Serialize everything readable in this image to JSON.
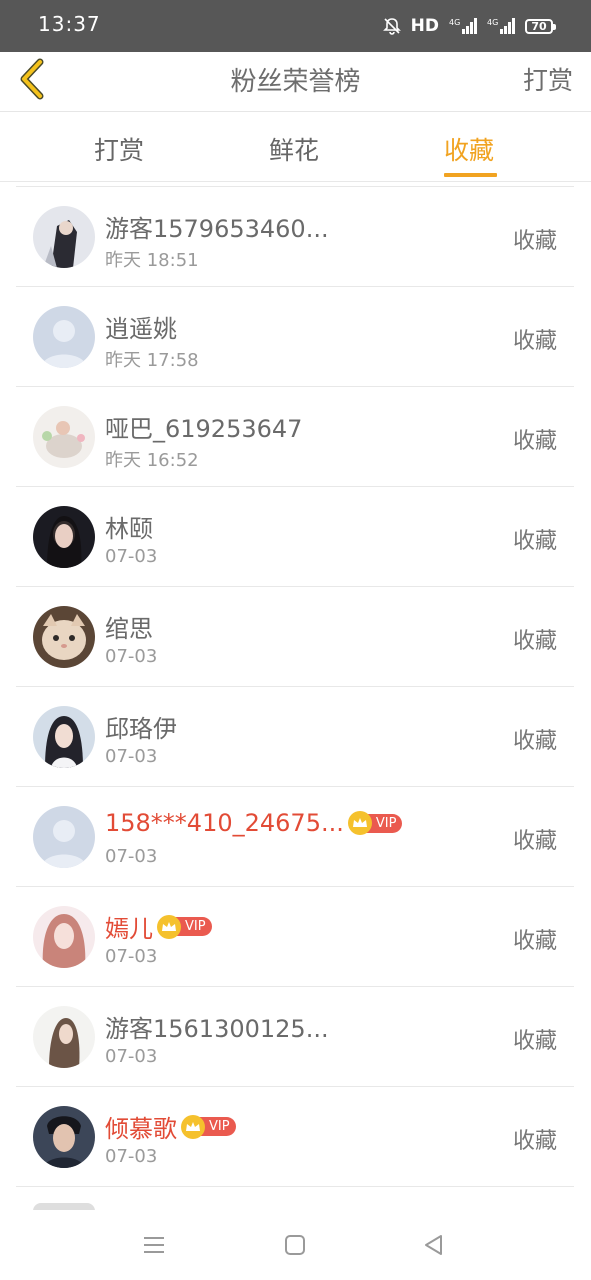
{
  "status_bar": {
    "time": "13:37",
    "network": "HD",
    "network_gen": "4G",
    "battery": "70"
  },
  "header": {
    "title": "粉丝荣誉榜",
    "action_label": "打赏",
    "back_icon": "chevron-left-icon",
    "accent_color": "#f1a321"
  },
  "tabs": [
    {
      "label": "打赏",
      "active": false
    },
    {
      "label": "鲜花",
      "active": false
    },
    {
      "label": "收藏",
      "active": true
    }
  ],
  "list": [
    {
      "name": "游客1579653460...",
      "time": "昨天 18:51",
      "action": "收藏",
      "vip": false
    },
    {
      "name": "逍遥姚",
      "time": "昨天 17:58",
      "action": "收藏",
      "vip": false
    },
    {
      "name": "哑巴_619253647",
      "time": "昨天 16:52",
      "action": "收藏",
      "vip": false
    },
    {
      "name": "林颐",
      "time": "07-03",
      "action": "收藏",
      "vip": false
    },
    {
      "name": "绾思",
      "time": "07-03",
      "action": "收藏",
      "vip": false
    },
    {
      "name": "邱珞伊",
      "time": "07-03",
      "action": "收藏",
      "vip": false
    },
    {
      "name": "158***410_24675...",
      "time": "07-03",
      "action": "收藏",
      "vip": true,
      "vip_label": "VIP"
    },
    {
      "name": "嫣儿",
      "time": "07-03",
      "action": "收藏",
      "vip": true,
      "vip_label": "VIP"
    },
    {
      "name": "游客1561300125...",
      "time": "07-03",
      "action": "收藏",
      "vip": false
    },
    {
      "name": "倾慕歌",
      "time": "07-03",
      "action": "收藏",
      "vip": true,
      "vip_label": "VIP"
    }
  ],
  "system_nav": {
    "menu_icon": "menu-icon",
    "home_icon": "home-square-icon",
    "back_icon": "back-triangle-icon"
  }
}
